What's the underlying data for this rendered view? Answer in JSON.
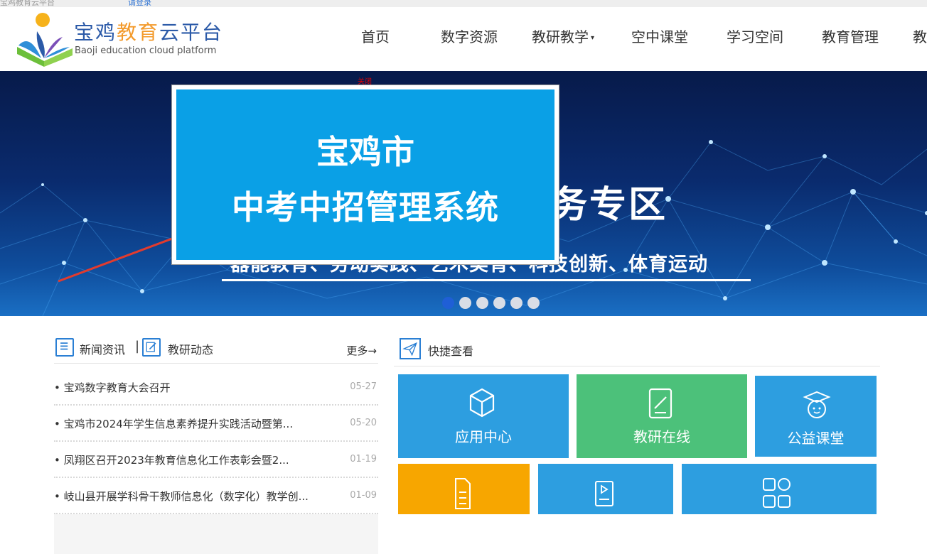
{
  "topbar": {
    "left_text": "宝鸡教育云平台",
    "right_text": "请登录"
  },
  "brand": {
    "cn_part1": "宝鸡",
    "cn_part2": "教育",
    "cn_part3": "云平台",
    "en": "Baoji education cloud platform"
  },
  "nav": {
    "items": [
      {
        "label": "首页"
      },
      {
        "label": "数字资源"
      },
      {
        "label": "教研教学"
      },
      {
        "label": "空中课堂"
      },
      {
        "label": "学习空间"
      },
      {
        "label": "教育管理"
      },
      {
        "label": "教"
      }
    ],
    "caret": "▾"
  },
  "banner": {
    "title_partial": "务专区",
    "subtitle_partial": "器能教育、劳动实践、艺术美育、科技创新、体育运动",
    "slides": 6,
    "active_slide": 1
  },
  "popup": {
    "close_label": "关闭",
    "line1": "宝鸡市",
    "line2": "中考中招管理系统"
  },
  "news": {
    "tab1": "新闻资讯",
    "separator": "|",
    "tab2": "教研动态",
    "more": "更多→",
    "items": [
      {
        "title": "• 宝鸡数字教育大会召开",
        "date": "05-27"
      },
      {
        "title": "• 宝鸡市2024年学生信息素养提升实践活动暨第...",
        "date": "05-20"
      },
      {
        "title": "• 凤翔区召开2023年教育信息化工作表彰会暨2...",
        "date": "01-19"
      },
      {
        "title": "• 岐山县开展学科骨干教师信息化（数字化）教学创...",
        "date": "01-09"
      }
    ]
  },
  "quick": {
    "title": "快捷查看",
    "tiles": [
      {
        "label": "应用中心",
        "color": "#2d9ee0",
        "icon": "cube-icon"
      },
      {
        "label": "教研在线",
        "color": "#4cc17a",
        "icon": "document-pen-icon"
      },
      {
        "label": "公益课堂",
        "color": "#2d9ee0",
        "icon": "student-cap-icon"
      },
      {
        "label": "",
        "color": "#f7a600",
        "icon": "file-icon"
      },
      {
        "label": "",
        "color": "#2d9ee0",
        "icon": "video-file-icon"
      },
      {
        "label": "",
        "color": "#2d9ee0",
        "icon": "apps-grid-icon"
      }
    ]
  }
}
